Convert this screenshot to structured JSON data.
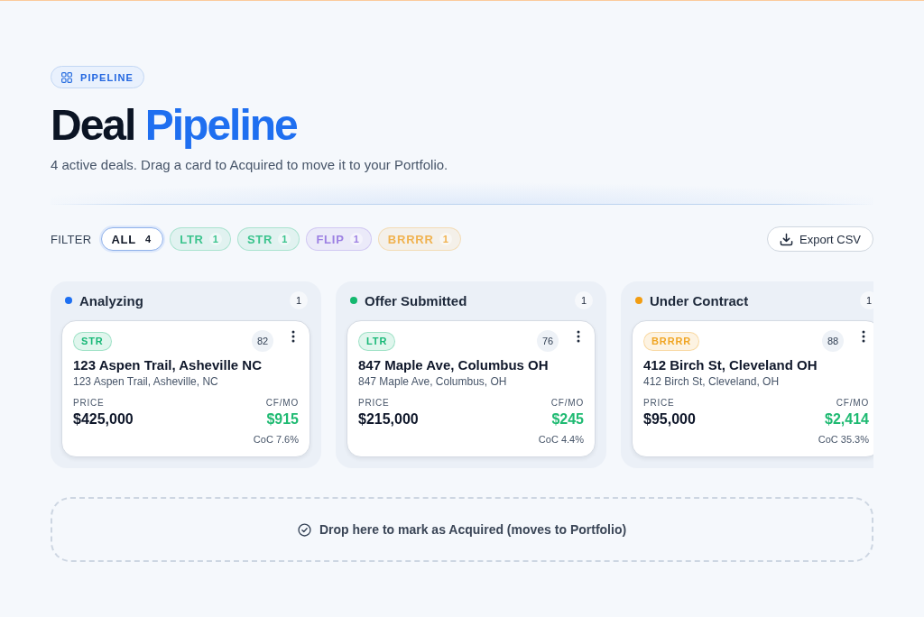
{
  "header": {
    "badge": "PIPELINE",
    "title": "Deal",
    "title_highlight": "Pipeline",
    "subtitle": "4 active deals. Drag a card to Acquired to move it to your Portfolio."
  },
  "filter": {
    "label": "FILTER",
    "chips": [
      {
        "label": "ALL",
        "count": "4",
        "selected": true,
        "color": "#111827"
      },
      {
        "label": "LTR",
        "count": "1",
        "selected": false,
        "color": "#3cc48e"
      },
      {
        "label": "STR",
        "count": "1",
        "selected": false,
        "color": "#3cc48e"
      },
      {
        "label": "FLIP",
        "count": "1",
        "selected": false,
        "color": "#9d80e3"
      },
      {
        "label": "BRRRR",
        "count": "1",
        "selected": false,
        "color": "#f0b24f"
      }
    ]
  },
  "export_button": "Export CSV",
  "columns": [
    {
      "title": "Analyzing",
      "color": "#1d6ff2",
      "count": "1",
      "cards": [
        {
          "tag": {
            "label": "STR",
            "color": "#18b877"
          },
          "score": "82",
          "title": "123 Aspen Trail, Asheville NC",
          "address": "123 Aspen Trail, Asheville, NC",
          "price_label": "PRICE",
          "price": "$425,000",
          "cashflow_label": "CF/MO",
          "cashflow": "$915",
          "coc": "CoC 7.6%"
        }
      ]
    },
    {
      "title": "Offer Submitted",
      "color": "#14b86f",
      "count": "1",
      "cards": [
        {
          "tag": {
            "label": "LTR",
            "color": "#18b877"
          },
          "score": "76",
          "title": "847 Maple Ave, Columbus OH",
          "address": "847 Maple Ave, Columbus, OH",
          "price_label": "PRICE",
          "price": "$215,000",
          "cashflow_label": "CF/MO",
          "cashflow": "$245",
          "coc": "CoC 4.4%"
        }
      ]
    },
    {
      "title": "Under Contract",
      "color": "#f29d12",
      "count": "1",
      "cards": [
        {
          "tag": {
            "label": "BRRRR",
            "color": "#f0a524"
          },
          "score": "88",
          "title": "412 Birch St, Cleveland OH",
          "address": "412 Birch St, Cleveland, OH",
          "price_label": "PRICE",
          "price": "$95,000",
          "cashflow_label": "CF/MO",
          "cashflow": "$2,414",
          "coc": "CoC 35.3%"
        }
      ]
    }
  ],
  "drop_zone": "Drop here to mark as Acquired (moves to Portfolio)"
}
